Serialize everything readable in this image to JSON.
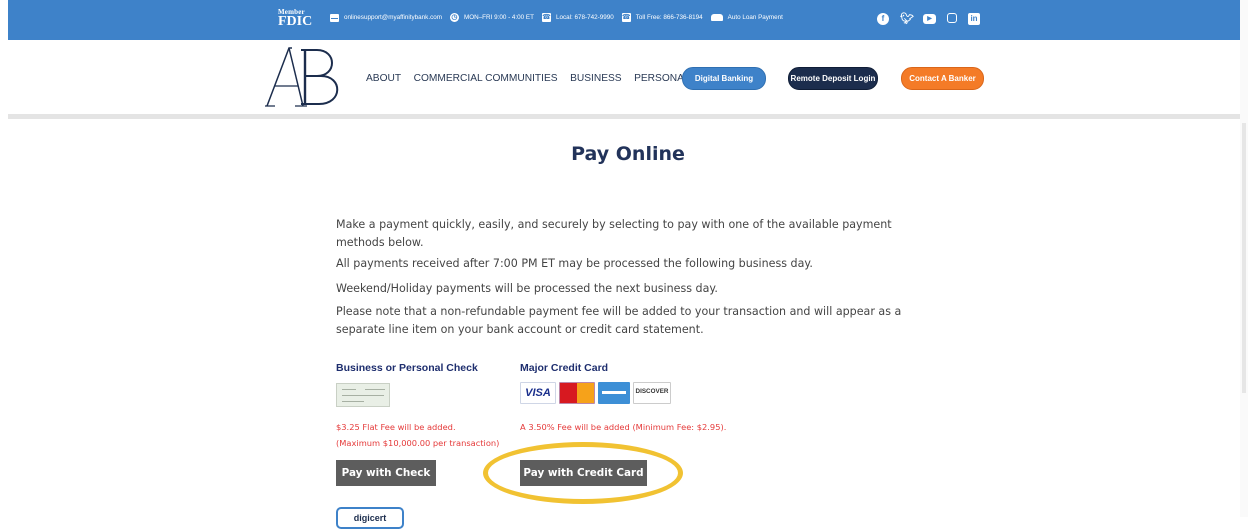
{
  "topbar": {
    "fdic_member": "Member",
    "fdic_label": "FDIC",
    "email": "onlinesupport@myaffinitybank.com",
    "hours": "MON–FRI 9:00 - 4:00 ET",
    "local_phone": "Local: 678-742-9990",
    "toll_free": "Toll Free: 866-736-8194",
    "auto_loan": "Auto Loan Payment",
    "social": [
      "facebook-icon",
      "twitter-icon",
      "youtube-icon",
      "instagram-icon",
      "linkedin-icon"
    ],
    "color": "#3e82c9"
  },
  "header": {
    "logo_text": "AB",
    "nav": [
      "ABOUT",
      "COMMERCIAL COMMUNITIES",
      "BUSINESS",
      "PERSONAL"
    ],
    "digital_banking": "Digital Banking Login",
    "remote_deposit": "Remote Deposit Login",
    "contact_banker": "Contact A Banker"
  },
  "main": {
    "title": "Pay Online",
    "paragraphs": [
      "Make a payment quickly, easily, and securely by selecting to pay with one of the available payment methods below.",
      "All payments received after 7:00 PM ET may be processed the following business day.",
      "Weekend/Holiday payments will be processed the next business day.",
      "Please note that a non-refundable payment fee will be added to your transaction and will appear as a separate line item on your bank account or credit card statement."
    ],
    "check": {
      "title": "Business or Personal Check",
      "fee_line1": "$3.25 Flat Fee will be added.",
      "fee_line2": "(Maximum $10,000.00 per transaction)",
      "button": "Pay with Check"
    },
    "card": {
      "title": "Major Credit Card",
      "brands": [
        "VISA",
        "MasterCard",
        "American Express",
        "DISCOVER"
      ],
      "fee": "A 3.50% Fee will be added (Minimum Fee: $2.95).",
      "button": "Pay with Credit Card"
    },
    "seal_text": "digicert"
  }
}
